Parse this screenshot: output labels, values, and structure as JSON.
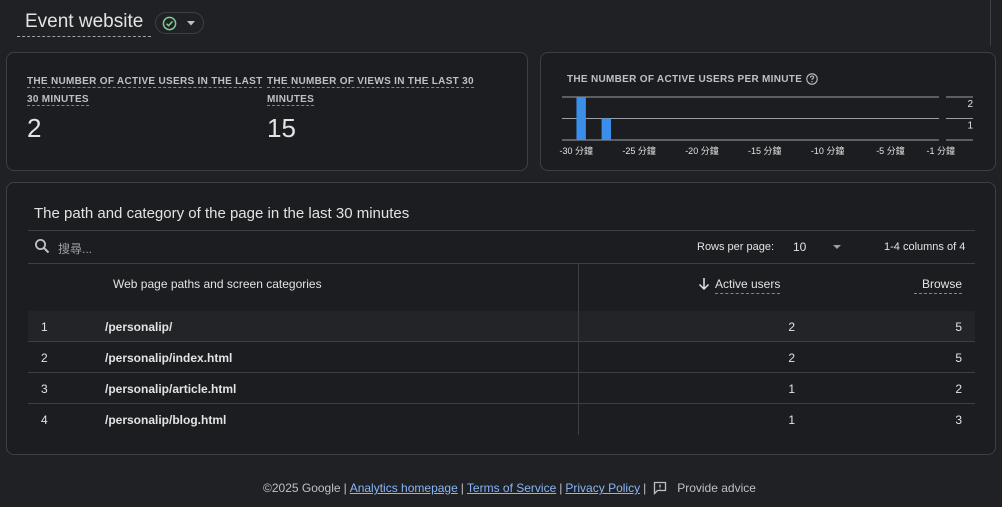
{
  "header": {
    "title": "Event website"
  },
  "metrics": [
    {
      "label_line1": "THE NUMBER OF ACTIVE USERS IN THE LAST",
      "label_line2": "30 MINUTES",
      "value": "2"
    },
    {
      "label_line1": "THE NUMBER OF VIEWS IN THE LAST 30",
      "label_line2": "MINUTES",
      "value": "15"
    }
  ],
  "chart": {
    "title": "THE NUMBER OF ACTIVE USERS PER MINUTE",
    "y_tick_labels": [
      "2",
      "1"
    ],
    "x_tick_labels": [
      "-30 分鐘",
      "-25 分鐘",
      "-20 分鐘",
      "-15 分鐘",
      "-10 分鐘",
      "-5 分鐘",
      "-1 分鐘"
    ],
    "bar_color": "#3b8eea"
  },
  "chart_data": {
    "type": "bar",
    "title": "THE NUMBER OF ACTIVE USERS PER MINUTE",
    "x": [
      -30,
      -29,
      -28,
      -27,
      -26,
      -25,
      -24,
      -23,
      -22,
      -21,
      -20,
      -19,
      -18,
      -17,
      -16,
      -15,
      -14,
      -13,
      -12,
      -11,
      -10,
      -9,
      -8,
      -7,
      -6,
      -5,
      -4,
      -3,
      -2,
      -1
    ],
    "values": [
      0,
      2,
      0,
      1,
      0,
      0,
      0,
      0,
      0,
      0,
      0,
      0,
      0,
      0,
      0,
      0,
      0,
      0,
      0,
      0,
      0,
      0,
      0,
      0,
      0,
      0,
      0,
      0,
      0,
      0
    ],
    "ylim": [
      0,
      2
    ],
    "grid": true
  },
  "table": {
    "title": "The path and category of the page in the last 30 minutes",
    "search_placeholder": "搜尋...",
    "rows_per_page_label": "Rows per page:",
    "rows_per_page_value": "10",
    "pagination": "1-4 columns of 4",
    "columns": {
      "path": "Web page paths and screen categories",
      "active": "Active users",
      "browse": "Browse"
    },
    "rows": [
      {
        "num": "1",
        "path": "/personalip/",
        "active": "2",
        "browse": "5"
      },
      {
        "num": "2",
        "path": "/personalip/index.html",
        "active": "2",
        "browse": "5"
      },
      {
        "num": "3",
        "path": "/personalip/article.html",
        "active": "1",
        "browse": "2"
      },
      {
        "num": "4",
        "path": "/personalip/blog.html",
        "active": "1",
        "browse": "3"
      }
    ]
  },
  "footer": {
    "copyright": "©2025 Google",
    "links": [
      "Analytics homepage",
      "Terms of Service",
      "Privacy Policy"
    ],
    "feedback": "Provide advice"
  }
}
